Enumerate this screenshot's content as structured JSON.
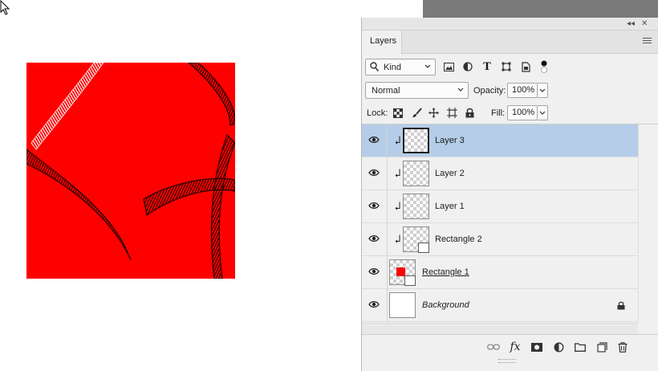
{
  "panel": {
    "collapse_glyph": "◂◂",
    "close_glyph": "✕",
    "tab_label": "Layers"
  },
  "filter": {
    "kind_value": "Kind",
    "icons": [
      "pixel-filter-icon",
      "adjustment-filter-icon",
      "type-filter-icon",
      "shape-filter-icon",
      "smart-object-filter-icon"
    ]
  },
  "blend": {
    "mode_value": "Normal",
    "opacity_label": "Opacity:",
    "opacity_value": "100%"
  },
  "lock": {
    "label": "Lock:",
    "fill_label": "Fill:",
    "fill_value": "100%"
  },
  "layers": [
    {
      "name": "Layer 3",
      "selected": true,
      "clipped": true
    },
    {
      "name": "Layer 2",
      "selected": false,
      "clipped": true
    },
    {
      "name": "Layer 1",
      "selected": false,
      "clipped": true
    },
    {
      "name": "Rectangle 2",
      "selected": false,
      "clipped": true
    },
    {
      "name": "Rectangle 1",
      "selected": false,
      "clipped": false
    },
    {
      "name": "Background",
      "selected": false,
      "clipped": false,
      "locked": true
    }
  ],
  "bottom_bar": {
    "fx_label": "fx",
    "icons": [
      "link-layers-icon",
      "layer-style-icon",
      "add-mask-icon",
      "adjustment-layer-icon",
      "new-group-icon",
      "new-layer-icon",
      "delete-layer-icon"
    ]
  },
  "colors": {
    "canvas_fill": "#ff0000",
    "selected_row": "#b5cde8",
    "pasteboard": "#7a7a7a"
  }
}
